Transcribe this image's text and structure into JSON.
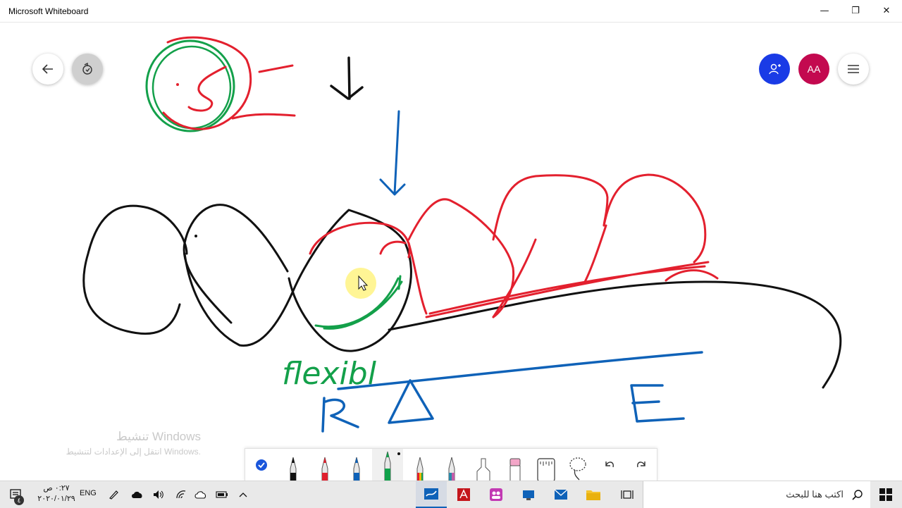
{
  "app": {
    "title": "Microsoft Whiteboard"
  },
  "window_controls": {
    "minimize": "—",
    "restore": "❐",
    "close": "✕"
  },
  "top_left_buttons": [
    {
      "icon": "back-arrow-icon"
    },
    {
      "icon": "rotate-view-icon"
    }
  ],
  "top_right": {
    "invite_icon": "add-person-icon",
    "avatar_initials": "AA",
    "menu_icon": "hamburger-menu-icon",
    "invite_color": "#1a3be6",
    "avatar_color": "#c3094f"
  },
  "canvas_text": {
    "word": "flexibl",
    "label_r": "R",
    "label_e": "E"
  },
  "activation_watermark": {
    "line1": "تنشيط Windows",
    "line2": "انتقل إلى الإعدادات لتنشيط Windows."
  },
  "ink_toolbar": {
    "tools": [
      {
        "name": "select",
        "icon": "checkmark-icon"
      },
      {
        "name": "pen-black",
        "color": "#111111"
      },
      {
        "name": "pen-red",
        "color": "#e0202e"
      },
      {
        "name": "pen-blue",
        "color": "#0f62b8"
      },
      {
        "name": "pen-green",
        "color": "#10a14a",
        "selected": true
      },
      {
        "name": "pen-rainbow",
        "color": "#e0202e"
      },
      {
        "name": "pen-galaxy",
        "color": "#2b8aa8"
      },
      {
        "name": "highlighter",
        "color": "#ffffff"
      },
      {
        "name": "eraser",
        "color": "#f3a6c8"
      },
      {
        "name": "ruler",
        "icon": "ruler-icon"
      },
      {
        "name": "lasso",
        "icon": "lasso-icon"
      },
      {
        "name": "undo",
        "icon": "undo-icon"
      },
      {
        "name": "redo",
        "icon": "redo-icon"
      }
    ]
  },
  "taskbar": {
    "search_placeholder": "اكتب هنا للبحث",
    "clock_time": "٠:٢٧ ص",
    "clock_date": "٢٠٢٠/٠١/٢٩",
    "language": "ENG",
    "notification_badge": "٤"
  },
  "ink_colors": {
    "black": "#111111",
    "red": "#e3202e",
    "blue": "#0f62b8",
    "green": "#13a04a"
  }
}
